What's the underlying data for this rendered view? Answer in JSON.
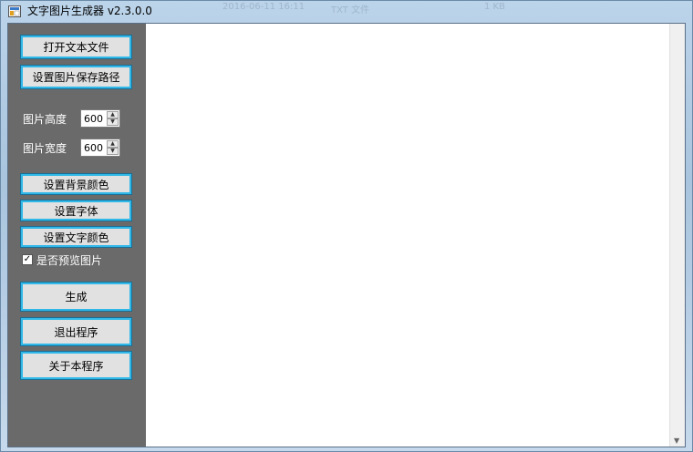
{
  "window": {
    "title": "文字图片生成器 v2.3.0.0"
  },
  "background_text": [
    "2016-06-11 16:11",
    "TXT 文件",
    "1 KB"
  ],
  "sidebar": {
    "open_file_label": "打开文本文件",
    "set_save_path_label": "设置图片保存路径",
    "height_label": "图片高度",
    "height_value": "600",
    "width_label": "图片宽度",
    "width_value": "600",
    "set_bg_color_label": "设置背景颜色",
    "set_font_label": "设置字体",
    "set_text_color_label": "设置文字颜色",
    "preview_checkbox_label": "是否预览图片",
    "preview_checked": true,
    "generate_label": "生成",
    "exit_label": "退出程序",
    "about_label": "关于本程序"
  },
  "colors": {
    "sidebar_bg": "#6a6a6a",
    "button_border": "#2fb8e8",
    "preview_bg": "#ffffff"
  }
}
